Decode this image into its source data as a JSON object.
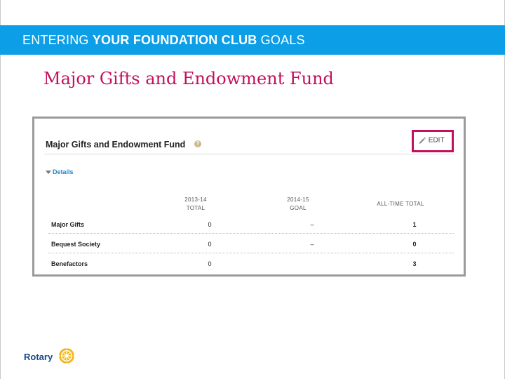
{
  "banner": {
    "title_prefix": "ENTERING ",
    "title_bold": "YOUR FOUNDATION CLUB",
    "title_suffix": " GOALS"
  },
  "slide_heading": "Major Gifts and Endowment Fund",
  "panel": {
    "title": "Major Gifts and Endowment Fund",
    "help_glyph": "?",
    "edit_label": "EDIT",
    "details_label": "Details",
    "columns": [
      {
        "line1": "2013-14",
        "line2": "TOTAL"
      },
      {
        "line1": "2014-15",
        "line2": "GOAL"
      },
      {
        "line1": "ALL-TIME TOTAL",
        "line2": ""
      }
    ],
    "rows": [
      {
        "label": "Major Gifts",
        "total": "0",
        "goal": "–",
        "all_time": "1"
      },
      {
        "label": "Bequest Society",
        "total": "0",
        "goal": "–",
        "all_time": "0"
      },
      {
        "label": "Benefactors",
        "total": "0",
        "goal": "",
        "all_time": "3"
      }
    ]
  },
  "logo": {
    "text": "Rotary",
    "wheel_color": "#f2b81d"
  }
}
